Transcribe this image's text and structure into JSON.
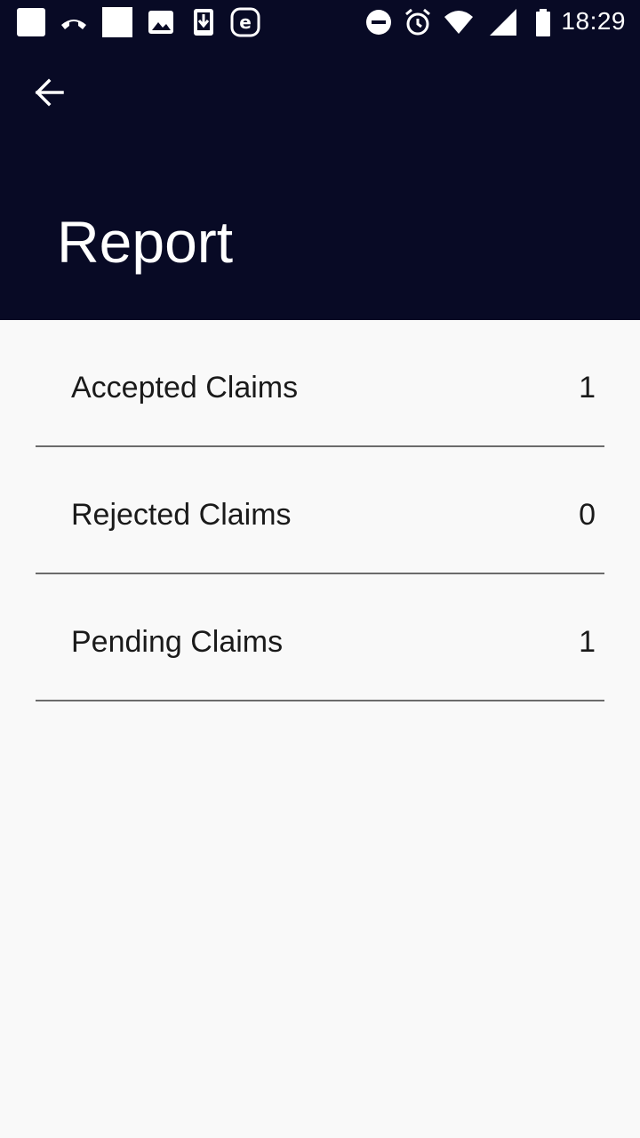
{
  "status_bar": {
    "time": "18:29",
    "left_icons": [
      "notification-square-icon",
      "missed-call-icon",
      "notification-square-icon",
      "image-icon",
      "download-icon",
      "e-app-icon"
    ],
    "right_icons": [
      "do-not-disturb-icon",
      "alarm-icon",
      "wifi-icon",
      "cell-signal-icon",
      "battery-icon"
    ]
  },
  "header": {
    "back_icon": "arrow-left-icon",
    "title": "Report",
    "background_color": "#080a25"
  },
  "report": {
    "items": [
      {
        "label": "Accepted Claims",
        "value": "1"
      },
      {
        "label": "Rejected Claims",
        "value": "0"
      },
      {
        "label": "Pending Claims",
        "value": "1"
      }
    ]
  }
}
